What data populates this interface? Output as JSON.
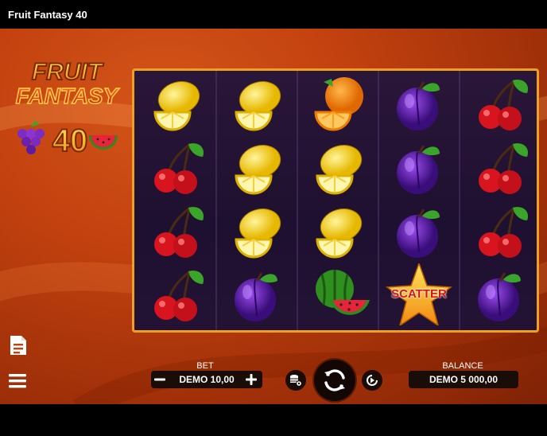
{
  "app": {
    "title": "Fruit Fantasy 40"
  },
  "logo": {
    "line1": "FRUIT",
    "line2": "FANTASY",
    "number": "40"
  },
  "reels": {
    "columns": [
      [
        "lemon",
        "cherry",
        "cherry",
        "cherry"
      ],
      [
        "lemon",
        "lemon",
        "lemon",
        "plum"
      ],
      [
        "orange",
        "lemon",
        "lemon",
        "watermelon"
      ],
      [
        "plum",
        "plum",
        "plum",
        "scatter"
      ],
      [
        "cherry",
        "cherry",
        "cherry",
        "plum"
      ]
    ],
    "scatter_label": "SCATTER"
  },
  "bet": {
    "label": "BET",
    "value": "DEMO 10,00"
  },
  "balance": {
    "label": "BALANCE",
    "value": "DEMO 5 000,00"
  },
  "icons": {
    "paytable": "document-icon",
    "menu": "hamburger-menu-icon",
    "minus": "minus-icon",
    "plus": "plus-icon",
    "coins": "coins-settings-icon",
    "spin": "spin-arrows-icon",
    "autoplay": "autoplay-icon"
  },
  "colors": {
    "background": "#c2410f",
    "frame": "#f0a020",
    "reels_bg": "#1e1030"
  }
}
